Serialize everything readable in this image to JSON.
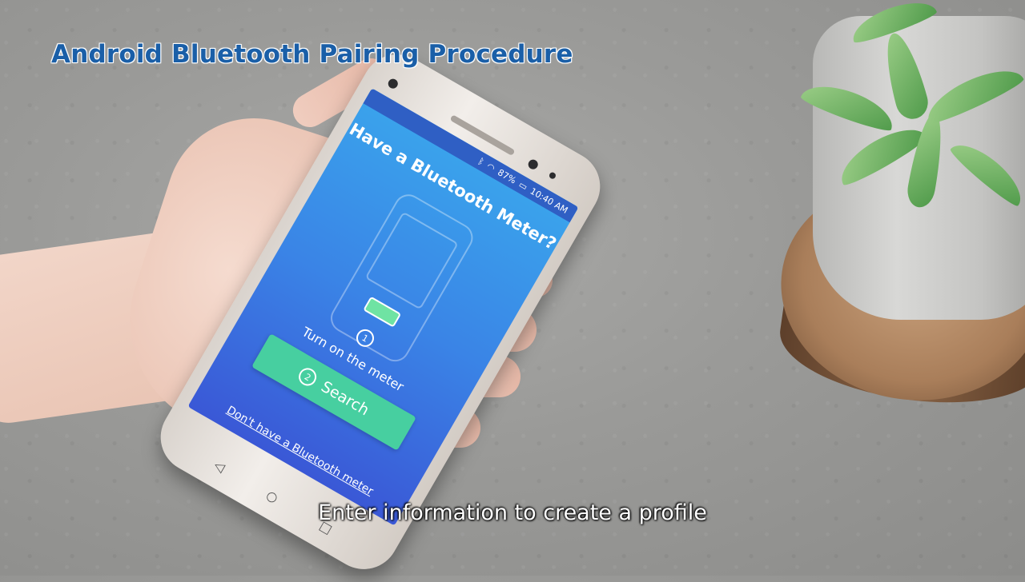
{
  "video": {
    "title": "Android Bluetooth Pairing Procedure",
    "subtitle": "Enter information to create a profile"
  },
  "phone_screen": {
    "status_time": "10:40 AM",
    "status_battery": "87%",
    "title": "Have a Bluetooth Meter?",
    "step1_number": "1",
    "step1_caption": "Turn on the meter",
    "step2_number": "2",
    "search_label": "Search",
    "no_meter_link": "Don't have a Bluetooth meter",
    "nav": {
      "back_icon": "◁",
      "home_icon": "○",
      "recents_icon": "□"
    }
  },
  "colors": {
    "title_blue": "#1a5fa8",
    "screen_gradient_top": "#3aa5ec",
    "screen_gradient_bottom": "#3a58d6",
    "search_button": "#47cfa0",
    "meter_button": "#6fe3a3"
  }
}
